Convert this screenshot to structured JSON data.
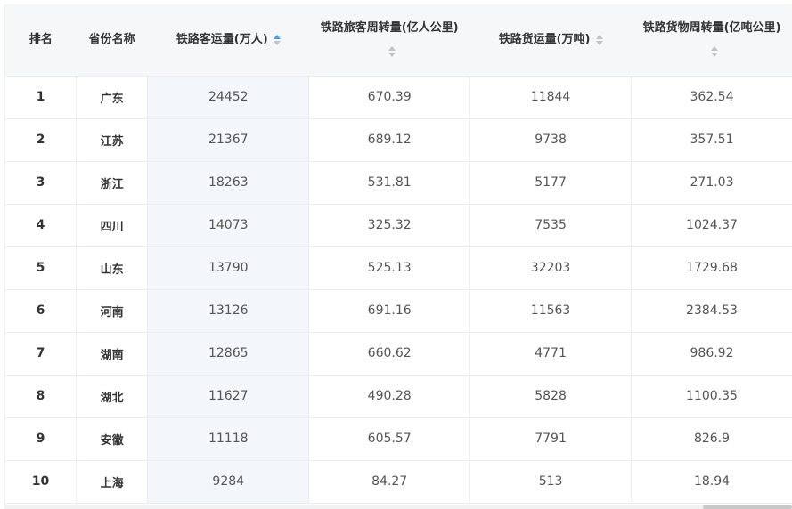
{
  "table": {
    "columns": [
      {
        "label": "排名"
      },
      {
        "label": "省份名称"
      },
      {
        "label": "铁路客运量(万人)",
        "sort": "asc"
      },
      {
        "label": "铁路旅客周转量(亿人公里)",
        "sort": "none"
      },
      {
        "label": "铁路货运量(万吨)",
        "sort": "none"
      },
      {
        "label": "铁路货物周转量(亿吨公里)",
        "sort": "none"
      }
    ],
    "rows": [
      {
        "rank": "1",
        "province": "广东",
        "passengers": "24452",
        "passenger_turnover": "670.39",
        "freight": "11844",
        "freight_turnover": "362.54"
      },
      {
        "rank": "2",
        "province": "江苏",
        "passengers": "21367",
        "passenger_turnover": "689.12",
        "freight": "9738",
        "freight_turnover": "357.51"
      },
      {
        "rank": "3",
        "province": "浙江",
        "passengers": "18263",
        "passenger_turnover": "531.81",
        "freight": "5177",
        "freight_turnover": "271.03"
      },
      {
        "rank": "4",
        "province": "四川",
        "passengers": "14073",
        "passenger_turnover": "325.32",
        "freight": "7535",
        "freight_turnover": "1024.37"
      },
      {
        "rank": "5",
        "province": "山东",
        "passengers": "13790",
        "passenger_turnover": "525.13",
        "freight": "32203",
        "freight_turnover": "1729.68"
      },
      {
        "rank": "6",
        "province": "河南",
        "passengers": "13126",
        "passenger_turnover": "691.16",
        "freight": "11563",
        "freight_turnover": "2384.53"
      },
      {
        "rank": "7",
        "province": "湖南",
        "passengers": "12865",
        "passenger_turnover": "660.62",
        "freight": "4771",
        "freight_turnover": "986.92"
      },
      {
        "rank": "8",
        "province": "湖北",
        "passengers": "11627",
        "passenger_turnover": "490.28",
        "freight": "5828",
        "freight_turnover": "1100.35"
      },
      {
        "rank": "9",
        "province": "安徽",
        "passengers": "11118",
        "passenger_turnover": "605.57",
        "freight": "7791",
        "freight_turnover": "826.9"
      },
      {
        "rank": "10",
        "province": "上海",
        "passengers": "9284",
        "passenger_turnover": "84.27",
        "freight": "513",
        "freight_turnover": "18.94"
      }
    ]
  }
}
